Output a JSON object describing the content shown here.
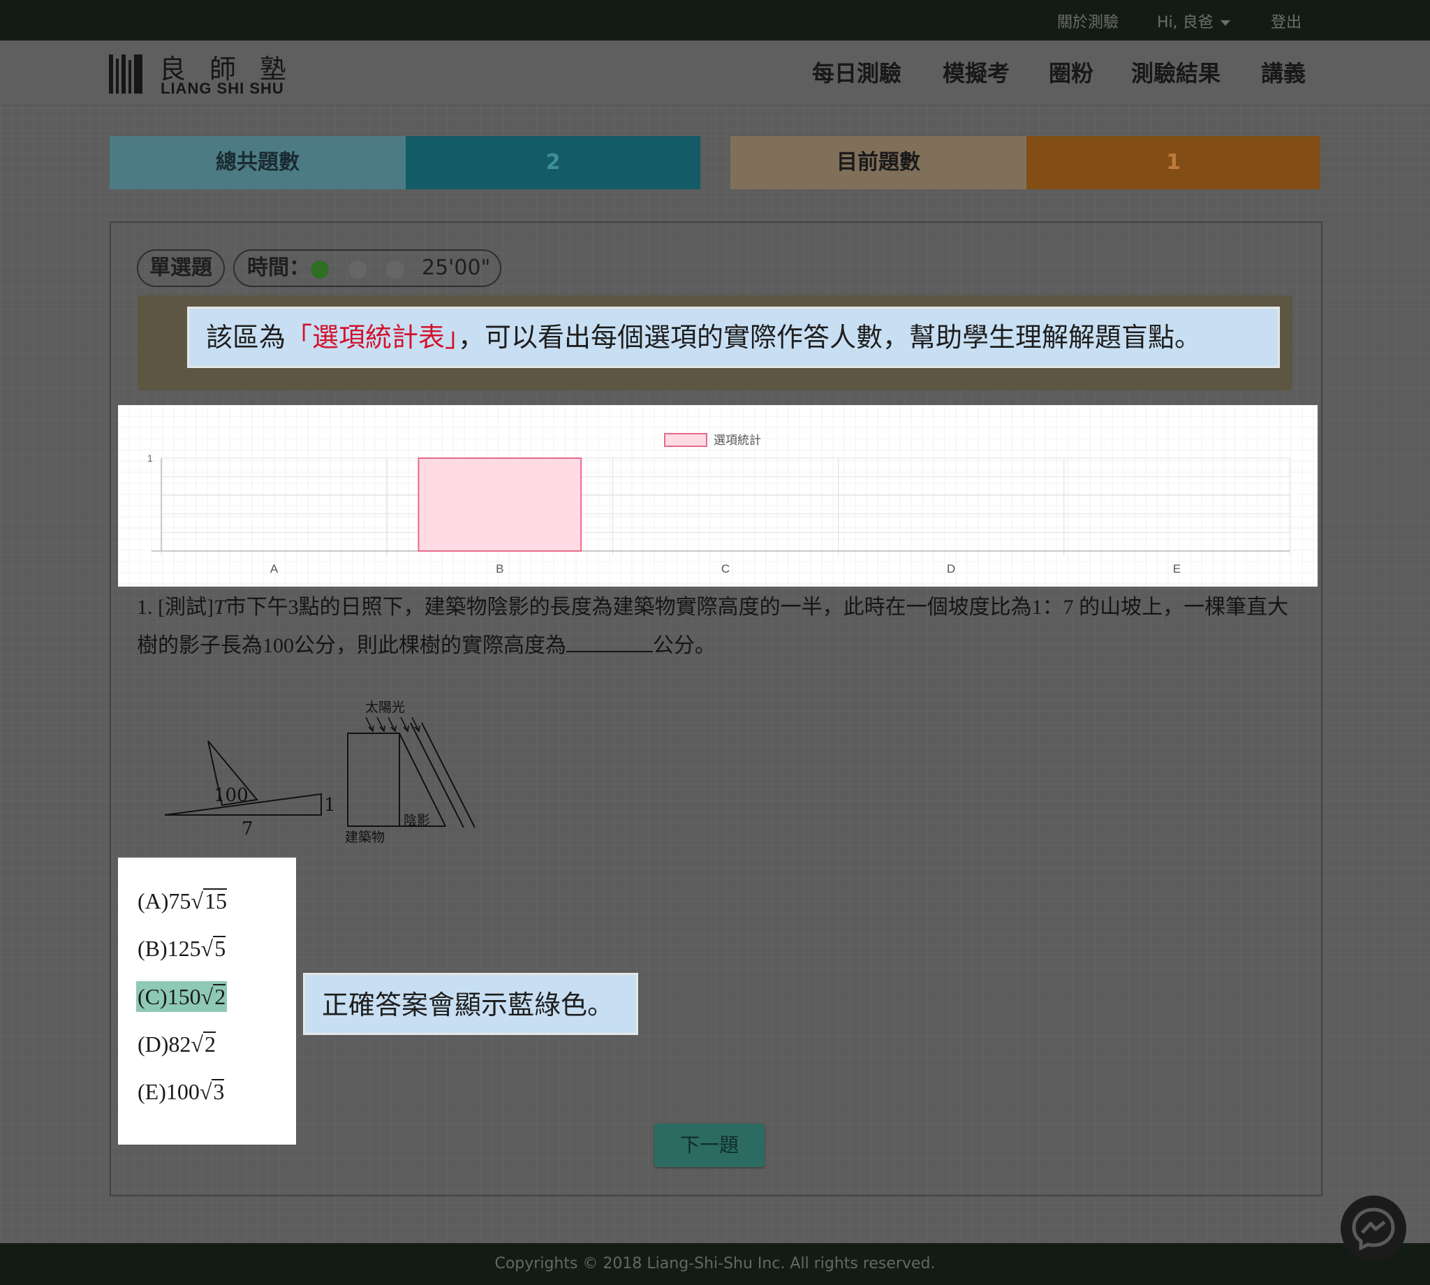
{
  "topbar": {
    "about": "關於測驗",
    "greeting": "Hi, 良爸",
    "logout": "登出"
  },
  "brand": {
    "name_cn": "良師塾",
    "name_en": "LIANG SHI SHU"
  },
  "nav": {
    "items": [
      {
        "label": "每日測驗"
      },
      {
        "label": "模擬考"
      },
      {
        "label": "圈粉"
      },
      {
        "label": "測驗結果"
      },
      {
        "label": "講義"
      }
    ]
  },
  "counters": {
    "total_label": "總共題數",
    "total_value": "2",
    "current_label": "目前題數",
    "current_value": "1"
  },
  "question_meta": {
    "type": "單選題",
    "time_label": "時間：",
    "time_value": "25'00\"",
    "timer_dots": [
      "#2f6e24",
      "#666666",
      "#666666"
    ]
  },
  "callouts": {
    "stats_prefix": "該區為",
    "stats_highlight": "「選項統計表」",
    "stats_suffix": "，可以看出每個選項的實際作答人數，幫助學生理解解題盲點。",
    "correct_note": "正確答案會顯示藍綠色。"
  },
  "chart_data": {
    "type": "bar",
    "categories": [
      "A",
      "B",
      "C",
      "D",
      "E"
    ],
    "series": [
      {
        "name": "選項統計",
        "values": [
          0,
          1,
          0,
          0,
          0
        ]
      }
    ],
    "ylim": [
      0,
      1
    ],
    "yticks": [
      "1"
    ],
    "legend": "top-center",
    "bar_color": "#ffdce5",
    "bar_border": "#e86a8a",
    "grid": true
  },
  "question": {
    "number": "1.",
    "text_part1": "[測試]",
    "italic_t": "T",
    "text_part2": "市下午3點的日照下，建築物陰影的長度為建築物實際高度的一半，此時在一個坡度比為1：7 的山坡上，一棵筆直大樹的影子長為100公分，則此棵樹的實際高度為",
    "text_part3": "公分。",
    "figure": {
      "sunlight": "太陽光",
      "building": "建築物",
      "shadow": "陰影",
      "len_100": "100",
      "len_7": "7",
      "len_1": "1"
    }
  },
  "options": [
    {
      "label": "(A)75",
      "root": "15",
      "correct": false
    },
    {
      "label": "(B)125",
      "root": "5",
      "correct": false
    },
    {
      "label": "(C)150",
      "root": "2",
      "correct": true
    },
    {
      "label": "(D)82",
      "root": "2",
      "correct": false
    },
    {
      "label": "(E)100",
      "root": "3",
      "correct": false
    }
  ],
  "next_button": "下一題",
  "footer": "Copyrights © 2018 Liang-Shi-Shu Inc. All rights reserved."
}
